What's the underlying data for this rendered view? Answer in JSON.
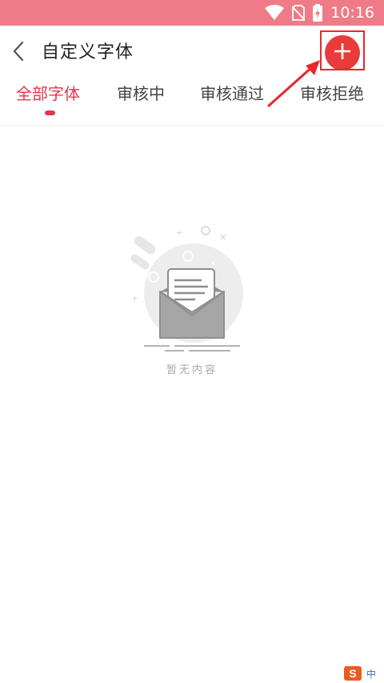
{
  "status_bar": {
    "time": "10:16",
    "icons": [
      "wifi-icon",
      "no-sim-icon",
      "battery-charging-icon"
    ],
    "background": "#ee7b87"
  },
  "header": {
    "title": "自定义字体",
    "back_icon": "chevron-left-icon",
    "add_icon": "plus-icon",
    "add_button_color": "#ea3b3b"
  },
  "tabs": [
    {
      "label": "全部字体",
      "active": true
    },
    {
      "label": "审核中",
      "active": false
    },
    {
      "label": "审核通过",
      "active": false
    },
    {
      "label": "审核拒绝",
      "active": false
    }
  ],
  "accent_color": "#e8334a",
  "annotation": {
    "color": "#e8272d"
  },
  "empty_state": {
    "icon": "empty-inbox-envelope-icon",
    "text": "暂无内容"
  },
  "ime": {
    "logo": "S",
    "mode": "中"
  }
}
